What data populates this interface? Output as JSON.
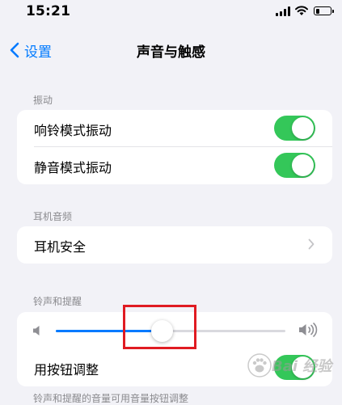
{
  "status_bar": {
    "time": "15:21",
    "battery_level": 0.3
  },
  "nav": {
    "back_label": "设置",
    "title": "声音与触感"
  },
  "sections": {
    "vibration": {
      "header": "振动",
      "rows": [
        {
          "label": "响铃模式振动",
          "on": true
        },
        {
          "label": "静音模式振动",
          "on": true
        }
      ]
    },
    "headphone_audio": {
      "header": "耳机音频",
      "rows": [
        {
          "label": "耳机安全"
        }
      ]
    },
    "ringtones_alerts": {
      "header": "铃声和提醒",
      "volume": 0.46,
      "change_with_buttons_label": "用按钮调整",
      "change_with_buttons_on": true,
      "footer": "铃声和提醒的音量可用音量按钮调整"
    }
  },
  "watermark": {
    "text": "Bai 经验"
  },
  "colors": {
    "accent": "#007aff",
    "toggle_on": "#34c759",
    "annotation": "#e01b22",
    "background": "#f2f2f7"
  }
}
